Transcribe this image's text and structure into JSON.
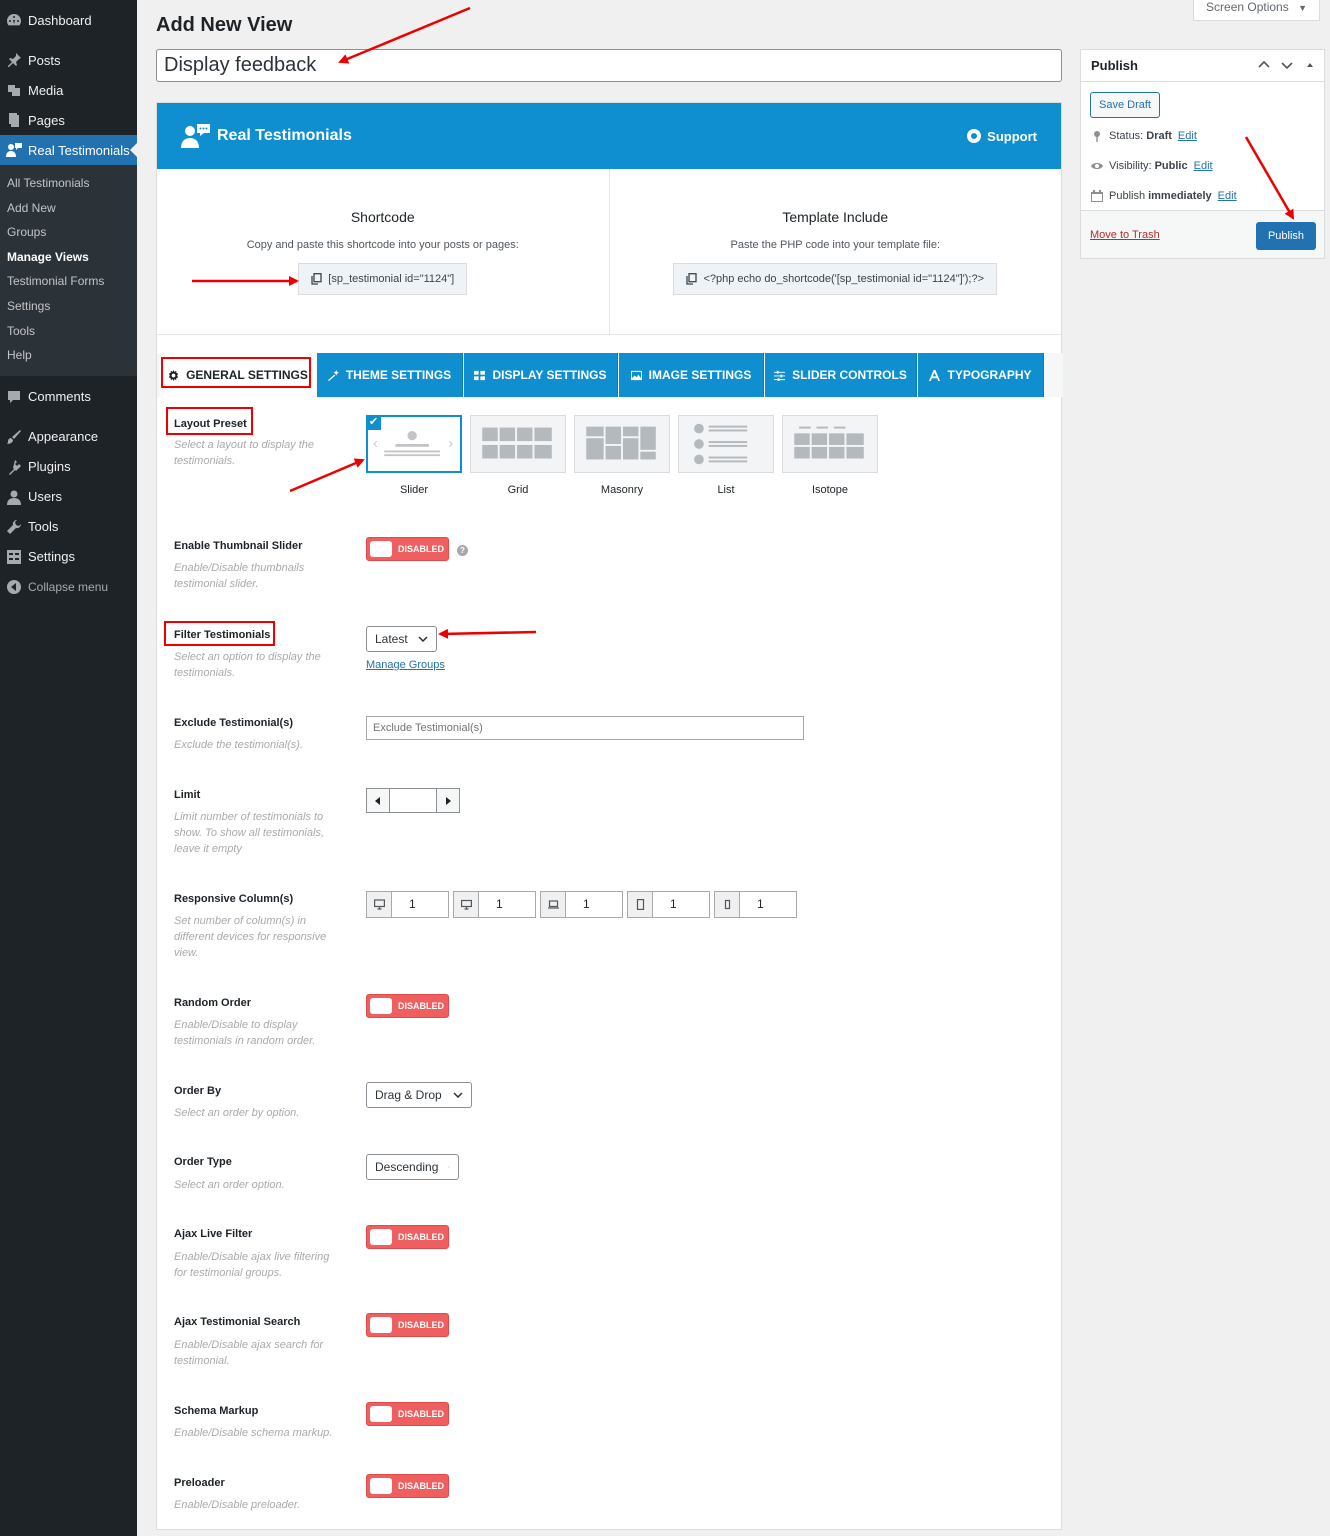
{
  "sidebar": {
    "dashboard": "Dashboard",
    "posts": "Posts",
    "media": "Media",
    "pages": "Pages",
    "real_testimonials": "Real Testimonials",
    "sub": [
      "All Testimonials",
      "Add New",
      "Groups",
      "Manage Views",
      "Testimonial Forms",
      "Settings",
      "Tools",
      "Help"
    ],
    "comments": "Comments",
    "appearance": "Appearance",
    "plugins": "Plugins",
    "users": "Users",
    "tools": "Tools",
    "settings": "Settings",
    "collapse": "Collapse menu"
  },
  "header": {
    "screen_options": "Screen Options",
    "page_title": "Add New View",
    "title_value": "Display feedback"
  },
  "plugin": {
    "brand": "Real Testimonials",
    "support": "Support",
    "shortcode_title": "Shortcode",
    "shortcode_desc": "Copy and paste this shortcode into your posts or pages:",
    "shortcode_code": "[sp_testimonial id=\"1124\"]",
    "template_title": "Template Include",
    "template_desc": "Paste the PHP code into your template file:",
    "template_code": "<?php echo do_shortcode('[sp_testimonial id=\"1124\"]');?>"
  },
  "tabs": [
    "GENERAL SETTINGS",
    "THEME SETTINGS",
    "DISPLAY SETTINGS",
    "IMAGE SETTINGS",
    "SLIDER CONTROLS",
    "TYPOGRAPHY"
  ],
  "fields": {
    "layout_label": "Layout Preset",
    "layout_help": "Select a layout to display the testimonials.",
    "layouts": [
      "Slider",
      "Grid",
      "Masonry",
      "List",
      "Isotope"
    ],
    "thumb_label": "Enable Thumbnail Slider",
    "thumb_help": "Enable/Disable thumbnails testimonial slider.",
    "disabled": "DISABLED",
    "help_icon": "?",
    "filter_label": "Filter Testimonials",
    "filter_help": "Select an option to display the testimonials.",
    "filter_value": "Latest",
    "manage_groups": "Manage Groups",
    "exclude_label": "Exclude Testimonial(s)",
    "exclude_help": "Exclude the testimonial(s).",
    "exclude_placeholder": "Exclude Testimonial(s)",
    "limit_label": "Limit",
    "limit_help": "Limit number of testimonials to show. To show all testimonials, leave it empty",
    "columns_label": "Responsive Column(s)",
    "columns_help": "Set number of column(s) in different devices for responsive view.",
    "columns": [
      "1",
      "1",
      "1",
      "1",
      "1"
    ],
    "random_label": "Random Order",
    "random_help": "Enable/Disable to display testimonials in random order.",
    "orderby_label": "Order By",
    "orderby_help": "Select an order by option.",
    "orderby_value": "Drag & Drop",
    "ordertype_label": "Order Type",
    "ordertype_help": "Select an order option.",
    "ordertype_value": "Descending",
    "ajaxfilter_label": "Ajax Live Filter",
    "ajaxfilter_help": "Enable/Disable ajax live filtering for testimonial groups.",
    "ajaxsearch_label": "Ajax Testimonial Search",
    "ajaxsearch_help": "Enable/Disable ajax search for testimonial.",
    "schema_label": "Schema Markup",
    "schema_help": "Enable/Disable schema markup.",
    "preloader_label": "Preloader",
    "preloader_help": "Enable/Disable preloader."
  },
  "publish": {
    "title": "Publish",
    "save_draft": "Save Draft",
    "status_label": "Status:",
    "status_value": "Draft",
    "visibility_label": "Visibility:",
    "visibility_value": "Public",
    "publish_label": "Publish",
    "publish_value": "immediately",
    "edit": "Edit",
    "trash": "Move to Trash",
    "publish_btn": "Publish"
  },
  "colors": {
    "accent": "#2271b1",
    "plugin_blue": "#0f8fd0",
    "toggle_red": "#f05f5f",
    "annotation_red": "#ee0000"
  }
}
